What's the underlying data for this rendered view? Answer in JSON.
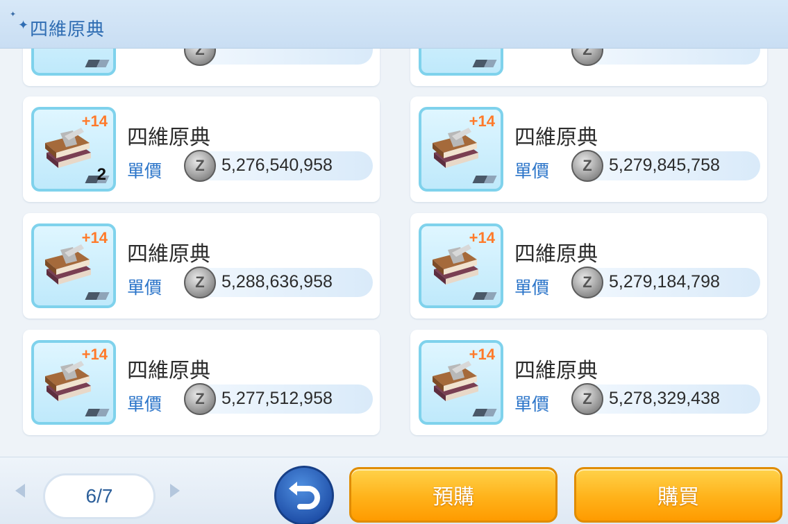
{
  "header": {
    "title": "四維原典"
  },
  "items": [
    {
      "name": "四維原典",
      "refine": "+14",
      "quantity": "2",
      "price_label": "單價",
      "price": "5,276,540,958"
    },
    {
      "name": "四維原典",
      "refine": "+14",
      "quantity": "",
      "price_label": "單價",
      "price": "5,279,845,758"
    },
    {
      "name": "四維原典",
      "refine": "+14",
      "quantity": "",
      "price_label": "單價",
      "price": "5,288,636,958"
    },
    {
      "name": "四維原典",
      "refine": "+14",
      "quantity": "",
      "price_label": "單價",
      "price": "5,279,184,798"
    },
    {
      "name": "四維原典",
      "refine": "+14",
      "quantity": "",
      "price_label": "單價",
      "price": "5,277,512,958"
    },
    {
      "name": "四維原典",
      "refine": "+14",
      "quantity": "",
      "price_label": "單價",
      "price": "5,278,329,438"
    }
  ],
  "currency_icon": "zeny-coin-icon",
  "pagination": {
    "page": "6/7"
  },
  "footer": {
    "prebuy_label": "預購",
    "buy_label": "購買"
  },
  "colors": {
    "accent_blue": "#2f6db3",
    "button_orange": "#ffb21a",
    "thumb_border": "#7fd2ec"
  }
}
